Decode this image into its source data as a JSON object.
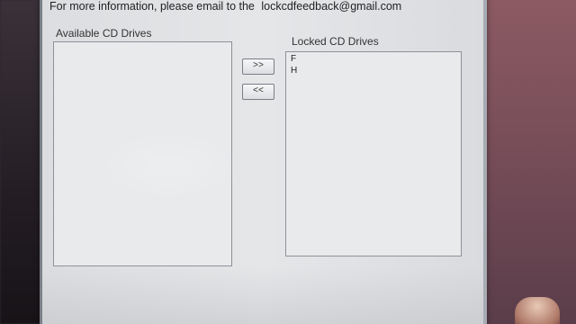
{
  "dialog": {
    "info_prefix": "For more information, please email to the",
    "email": "lockcdfeedback@gmail.com"
  },
  "available": {
    "label": "Available CD Drives",
    "items": []
  },
  "locked": {
    "label": "Locked CD Drives",
    "items": [
      "F",
      "H"
    ]
  },
  "buttons": {
    "add_label": ">>",
    "remove_label": "<<"
  }
}
